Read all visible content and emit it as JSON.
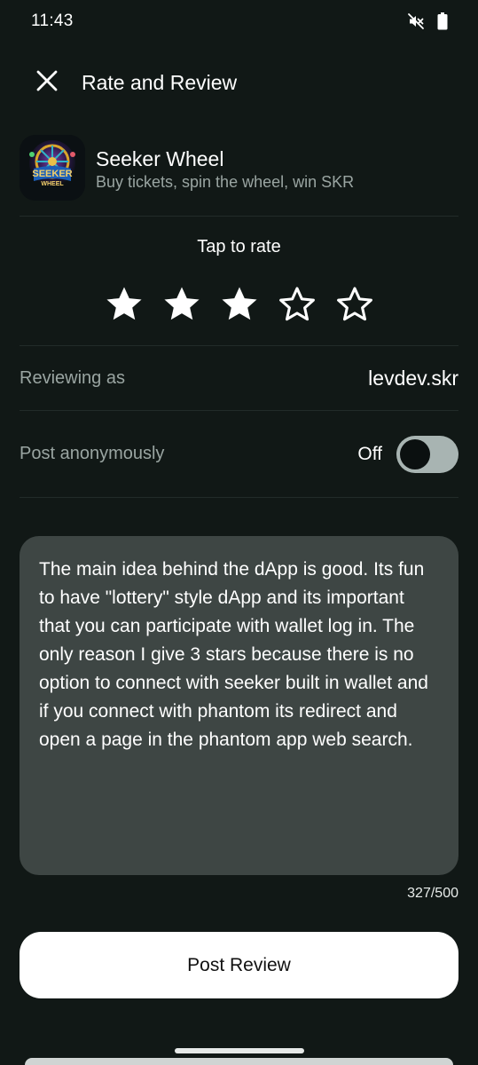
{
  "status_bar": {
    "time": "11:43",
    "icons": [
      "mute-icon",
      "battery-icon"
    ]
  },
  "header": {
    "title": "Rate and Review",
    "close_icon": "close-icon"
  },
  "app": {
    "name": "Seeker Wheel",
    "description": "Buy tickets, spin the wheel, win SKR",
    "icon_text_line1": "SEEKER",
    "icon_text_line2": "WHEEL"
  },
  "rating": {
    "label": "Tap to rate",
    "value": 3,
    "max": 5
  },
  "reviewer": {
    "label": "Reviewing as",
    "value": "levdev.skr"
  },
  "anonymous": {
    "label": "Post anonymously",
    "state_label": "Off",
    "enabled": false
  },
  "review": {
    "text": "The main idea behind the dApp is good. Its fun to have \"lottery\" style dApp and its important that you can participate with wallet log in. The only reason I give 3 stars because there is no option to connect with seeker built in wallet and if you connect with phantom its redirect and open a page in the phantom app web search.",
    "char_count": "327/500"
  },
  "actions": {
    "post_label": "Post Review"
  },
  "colors": {
    "background": "#111816",
    "review_box": "#3e4644",
    "toggle_track": "#a8b4b2",
    "muted_text": "#9aa5a2"
  }
}
